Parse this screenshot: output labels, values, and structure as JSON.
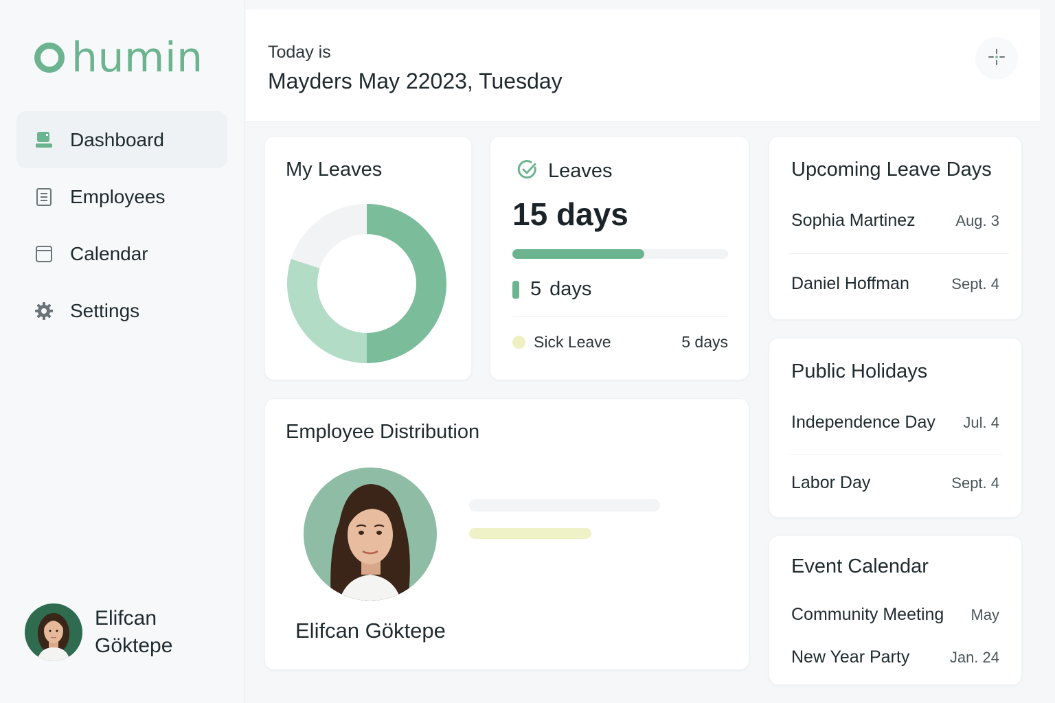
{
  "brand": {
    "name": "humin",
    "accent": "#6cb48f"
  },
  "sidebar": {
    "items": [
      {
        "label": "Dashboard",
        "icon": "dashboard-icon",
        "active": true
      },
      {
        "label": "Employees",
        "icon": "employees-icon"
      },
      {
        "label": "Calendar",
        "icon": "calendar-icon"
      },
      {
        "label": "Settings",
        "icon": "gear-icon"
      }
    ],
    "profile": {
      "name": "Elifcan Göktepe"
    }
  },
  "header": {
    "today_label": "Today is",
    "date": "Mayders May 22023, Tuesday",
    "action_icon": "sparkle-icon"
  },
  "my_leaves": {
    "title": "My Leaves",
    "chart_data": {
      "type": "pie",
      "variant": "donut",
      "slices": [
        {
          "fraction": 0.5,
          "color": "#7bbd9b"
        },
        {
          "fraction": 0.3,
          "color": "#b2dcc5"
        },
        {
          "fraction": 0.2,
          "color": "#f1f3f5"
        }
      ]
    }
  },
  "leaves": {
    "title": "Leaves",
    "total": "15 days",
    "progress_fraction": 0.61,
    "used_count": "5",
    "used_unit": "days",
    "sick_label": "Sick Leave",
    "sick_value": "5 days"
  },
  "employee_distribution": {
    "title": "Employee Distribution",
    "employee_name": "Elifcan Göktepe"
  },
  "upcoming": {
    "title": "Upcoming Leave Days",
    "items": [
      {
        "name": "Sophia Martinez",
        "date": "Aug. 3"
      },
      {
        "name": "Daniel Hoffman",
        "date": "Sept. 4"
      }
    ]
  },
  "holidays": {
    "title": "Public Holidays",
    "items": [
      {
        "name": "Independence Day",
        "date": "Jul. 4"
      },
      {
        "name": "Labor Day",
        "date": "Sept. 4"
      }
    ]
  },
  "events": {
    "title": "Event Calendar",
    "items": [
      {
        "name": "Community Meeting",
        "date": "May"
      },
      {
        "name": "New Year Party",
        "date": "Jan. 24"
      }
    ]
  }
}
